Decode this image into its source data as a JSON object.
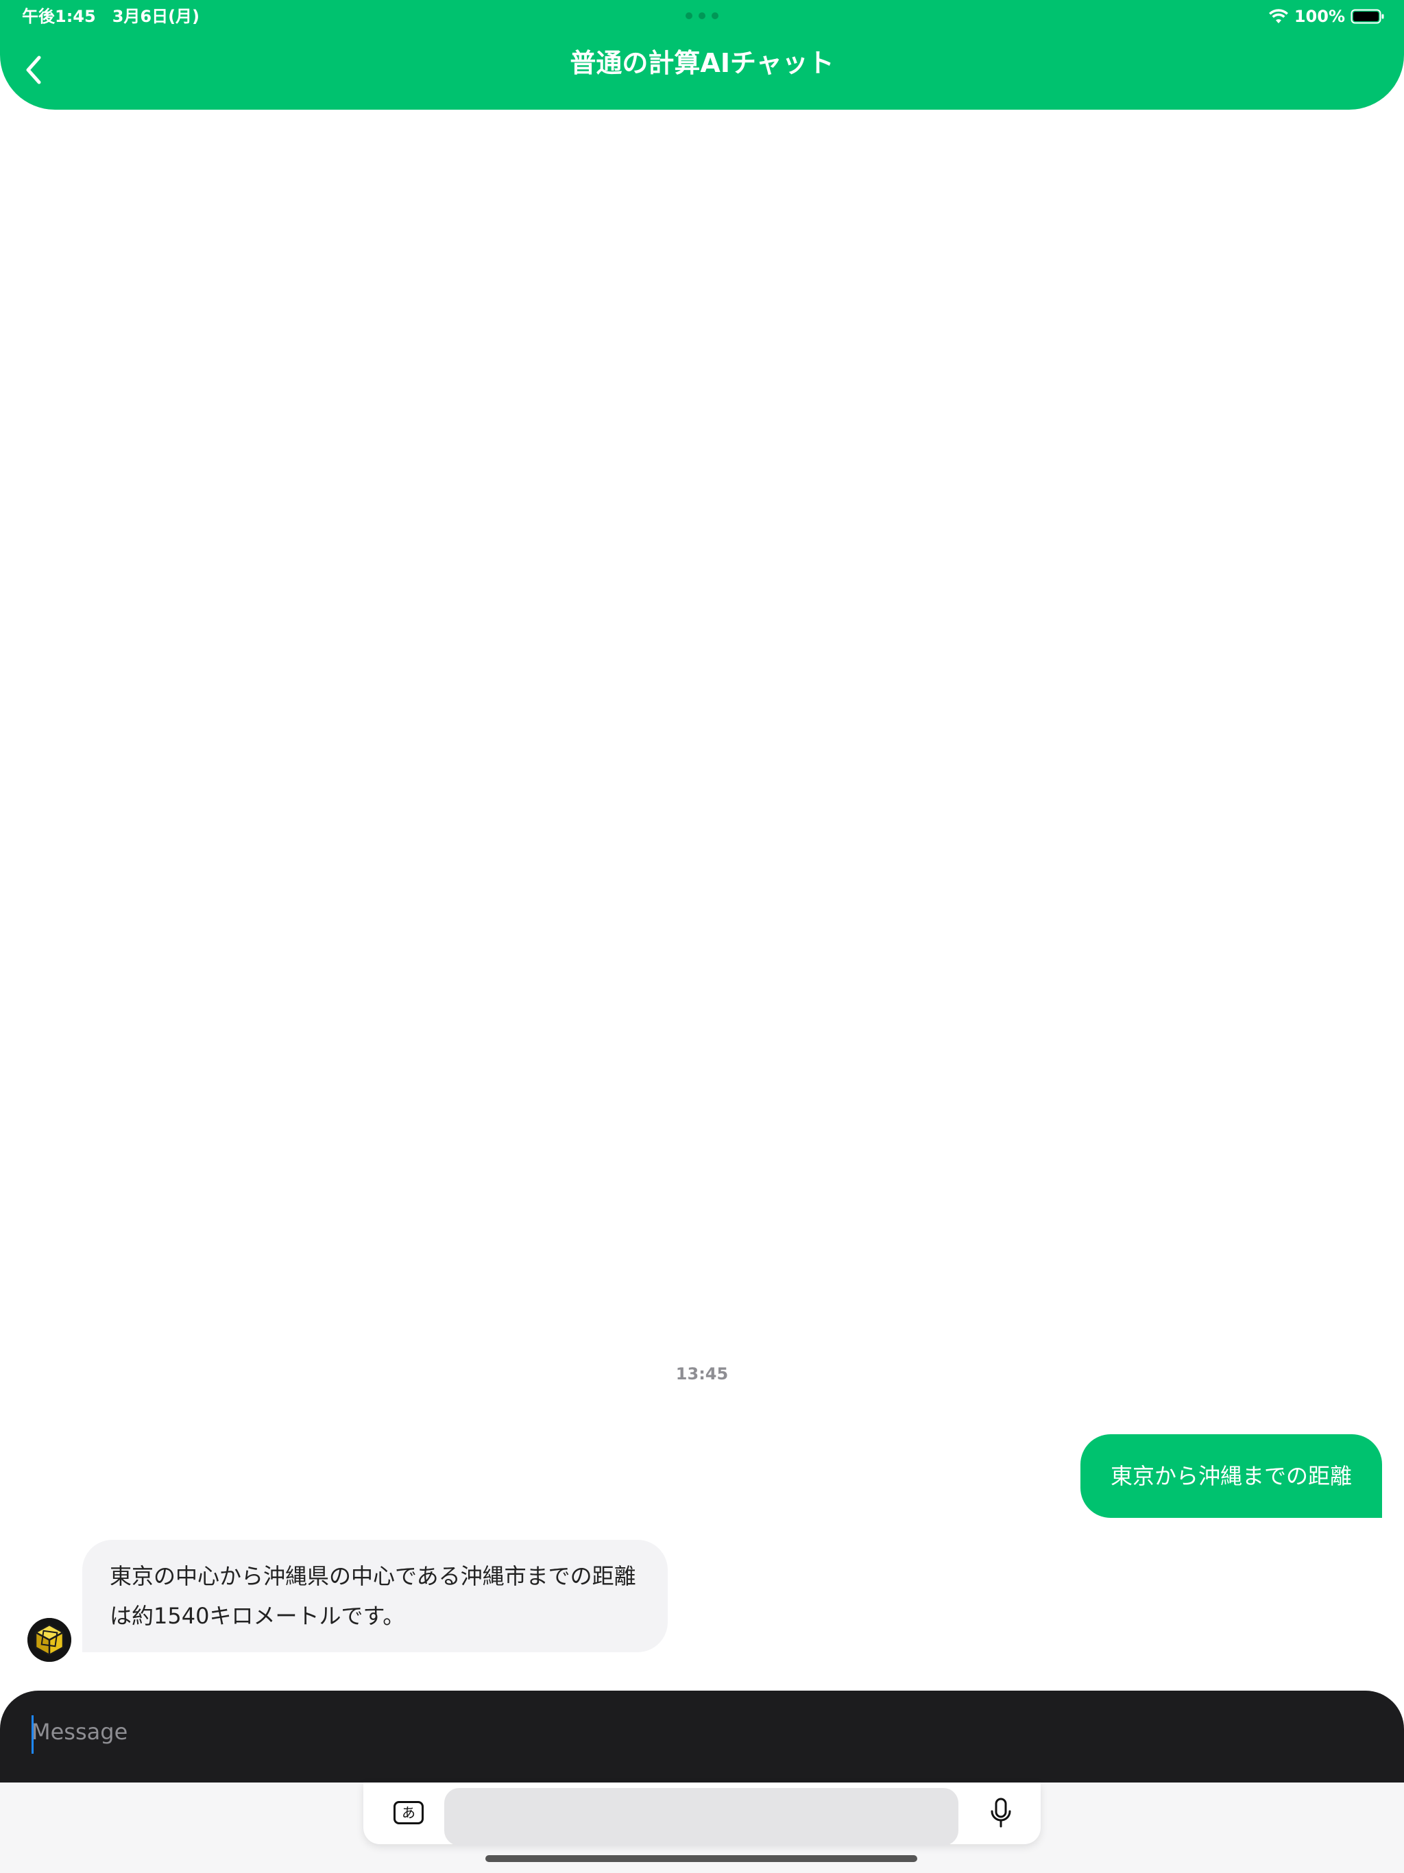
{
  "status_bar": {
    "time": "午後1:45　3月6日(月)",
    "battery": "100%",
    "icons": [
      "wifi-icon",
      "battery-icon"
    ]
  },
  "header": {
    "title": "普通の計算AIチャット",
    "back_icon": "chevron-left-icon",
    "color": "#00c26f"
  },
  "chat": {
    "timestamp": "13:45",
    "messages": [
      {
        "sender": "user",
        "text": "東京から沖縄までの距離"
      },
      {
        "sender": "bot",
        "text": "東京の中心から沖縄県の中心である沖縄市までの距離は約1540キロメートルです。"
      }
    ],
    "bot_avatar": "cube-avatar-icon"
  },
  "input": {
    "placeholder": "Message",
    "value": ""
  },
  "keyboard": {
    "lang_key": "あ",
    "mic_icon": "microphone-icon"
  },
  "colors": {
    "accent": "#00c26f",
    "input_bar": "#1c1c1e",
    "bot_bubble": "#f3f3f5"
  }
}
